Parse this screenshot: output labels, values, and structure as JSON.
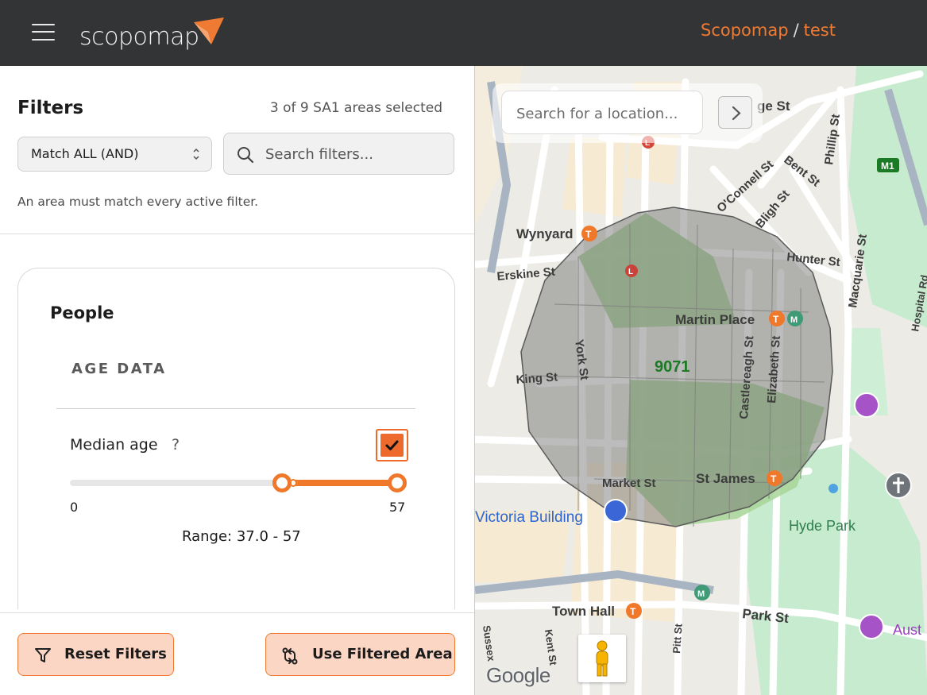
{
  "header": {
    "brand_name": "scopomap",
    "crumb_root": "Scopomap",
    "crumb_separator": "/",
    "crumb_current": "test",
    "accent_color": "#ee7a33"
  },
  "filters": {
    "title": "Filters",
    "selection_status": "3 of 9 SA1 areas selected",
    "match_mode": "Match ALL (AND)",
    "search_placeholder": "Search filters...",
    "hint": "An area must match every active filter."
  },
  "card": {
    "title": "People",
    "section": "AGE DATA",
    "metric": {
      "label": "Median age",
      "help": "?",
      "checked": true,
      "min_label": "0",
      "max_label": "57",
      "range_low": 37.0,
      "range_high": 57,
      "range_text": "Range: 37.0 - 57"
    }
  },
  "actions": {
    "reset_label": "Reset Filters",
    "use_label": "Use Filtered Area"
  },
  "map": {
    "search_placeholder": "Search for a location...",
    "area_label": "9071",
    "attribution": "Google",
    "labels": {
      "wynyard": "Wynyard",
      "erskine": "Erskine St",
      "martin_place": "Martin Place",
      "king_st": "King St",
      "york_st": "York St",
      "castlereagh": "Castlereagh St",
      "elizabeth": "Elizabeth St",
      "market_st": "Market St",
      "st_james": "St James",
      "victoria": "Victoria Building",
      "hyde_park": "Hyde Park",
      "town_hall": "Town Hall",
      "park_st": "Park St",
      "sussex": "Sussex",
      "kent": "Kent St",
      "pitt": "Pitt St",
      "george": "ge St",
      "hunter": "Hunter St",
      "macquarie": "Macquarie St",
      "phillip": "Phillip St",
      "bent": "Bent St",
      "bligh": "Bligh St",
      "oconnell": "O'Connell St",
      "hospital": "Hospital Rd",
      "aust": "Aust",
      "m1": "M1"
    }
  }
}
